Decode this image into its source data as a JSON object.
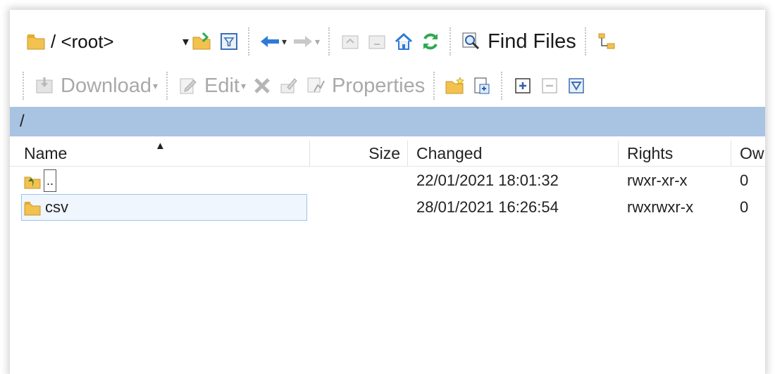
{
  "toolbar1": {
    "path_combo": "/ <root>",
    "find_files": "Find Files"
  },
  "toolbar2": {
    "download": "Download",
    "edit": "Edit",
    "properties": "Properties"
  },
  "path_bar": "/",
  "columns": {
    "name": "Name",
    "size": "Size",
    "changed": "Changed",
    "rights": "Rights",
    "owner": "Ow"
  },
  "files": [
    {
      "name": "..",
      "size": "",
      "changed": "22/01/2021 18:01:32",
      "rights": "rwxr-xr-x",
      "owner": "0"
    },
    {
      "name": "csv",
      "size": "",
      "changed": "28/01/2021 16:26:54",
      "rights": "rwxrwxr-x",
      "owner": "0"
    }
  ],
  "colors": {
    "path_bar": "#a9c3e2",
    "selection_border": "#9fc3ec",
    "folder": "#f2c14e",
    "nav_arrow": "#2f7ad8",
    "refresh": "#2fa84f"
  }
}
